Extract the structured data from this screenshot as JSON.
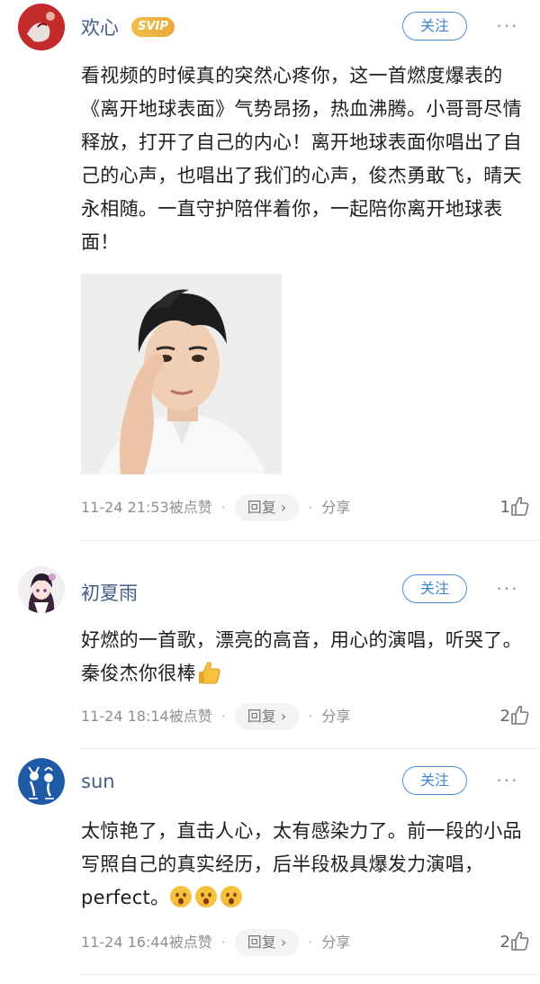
{
  "comments": [
    {
      "username": "欢心",
      "badge": "SVIP",
      "follow_label": "关注",
      "more_label": "···",
      "text": "看视频的时候真的突然心疼你，这一首燃度爆表的《离开地球表面》气势昂扬，热血沸腾。小哥哥尽情释放，打开了自己的内心！离开地球表面你唱出了自己的心声，也唱出了我们的心声，俊杰勇敢飞，晴天永相随。一直守护陪伴着你，一起陪你离开地球表面！",
      "timestamp": "11-24 21:53",
      "liked_by_label": "被点赞",
      "reply_label": "回复",
      "share_label": "分享",
      "like_count": "1"
    },
    {
      "username": "初夏雨",
      "follow_label": "关注",
      "more_label": "···",
      "text": "好燃的一首歌，漂亮的高音，用心的演唱，听哭了。秦俊杰你很棒",
      "timestamp": "11-24 18:14",
      "liked_by_label": "被点赞",
      "reply_label": "回复",
      "share_label": "分享",
      "like_count": "2"
    },
    {
      "username": "sun",
      "follow_label": "关注",
      "more_label": "···",
      "text": "太惊艳了，直击人心，太有感染力了。前一段的小品写照自己的真实经历，后半段极具爆发力演唱，perfect。",
      "timestamp": "11-24 16:44",
      "liked_by_label": "被点赞",
      "reply_label": "回复",
      "share_label": "分享",
      "like_count": "2"
    }
  ],
  "colors": {
    "username": "#3f5f8a",
    "follow": "#3f84d0",
    "svip": "#f2c04c"
  }
}
